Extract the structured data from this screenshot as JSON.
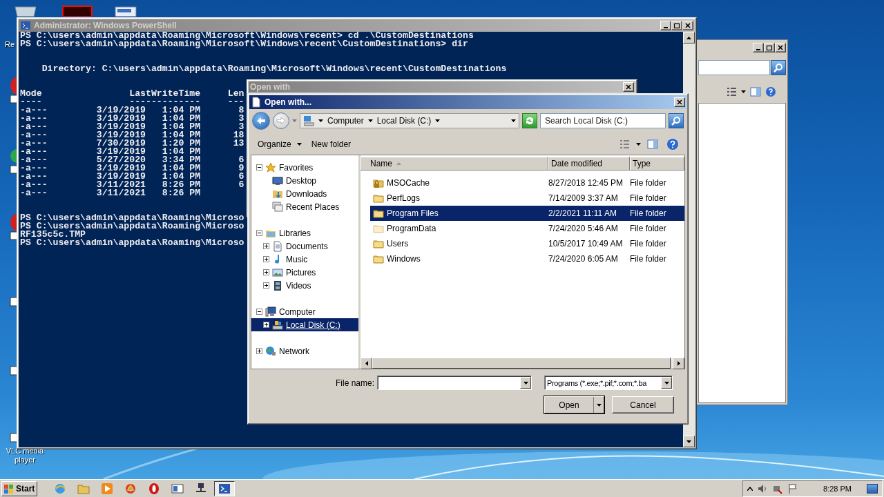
{
  "desktop": {
    "icon_labels": [
      "Re",
      "VLC media player"
    ]
  },
  "powershell": {
    "title": "Administrator: Windows PowerShell",
    "blocks": [
      {
        "lines": [
          "PS C:\\users\\admin\\appdata\\Roaming\\Microsoft\\Windows\\recent> cd .\\CustomDestinations",
          "PS C:\\users\\admin\\appdata\\Roaming\\Microsoft\\Windows\\recent\\CustomDestinations> dir"
        ]
      },
      {
        "lines": [
          "    Directory: C:\\users\\admin\\appdata\\Roaming\\Microsoft\\Windows\\recent\\CustomDestinations"
        ]
      },
      {
        "lines": [
          "Mode                LastWriteTime     Len",
          "----                -------------     ---",
          "-a---         3/19/2019   1:04 PM       8",
          "-a---         3/19/2019   1:04 PM       3",
          "-a---         3/19/2019   1:04 PM       3",
          "-a---         3/19/2019   1:04 PM      18",
          "-a---         7/30/2019   1:20 PM      13",
          "-a---         3/19/2019   1:04 PM",
          "-a---         5/27/2020   3:34 PM       6",
          "-a---         3/19/2019   1:04 PM       9",
          "-a---         3/19/2019   1:04 PM       6",
          "-a---         3/11/2021   8:26 PM       6",
          "-a---         3/11/2021   8:26 PM"
        ]
      },
      {
        "lines": [
          "PS C:\\users\\admin\\appdata\\Roaming\\Microso",
          "PS C:\\users\\admin\\appdata\\Roaming\\Microso",
          "RF135c5c.TMP",
          "PS C:\\users\\admin\\appdata\\Roaming\\Microso"
        ]
      }
    ]
  },
  "back_dialog": {
    "title": "Open with"
  },
  "dialog": {
    "title": "Open with...",
    "breadcrumb": [
      "Computer",
      "Local Disk (C:)"
    ],
    "search": {
      "placeholder": "Search Local Disk (C:)"
    },
    "toolbar": [
      "Organize",
      "New folder"
    ],
    "nav": {
      "groups": [
        {
          "label": "Favorites",
          "expanded": true,
          "selected": false,
          "children": [
            {
              "label": "Desktop",
              "selected": false
            },
            {
              "label": "Downloads",
              "selected": false
            },
            {
              "label": "Recent Places",
              "selected": false
            }
          ]
        },
        {
          "label": "Libraries",
          "expanded": true,
          "selected": false,
          "children": [
            {
              "label": "Documents",
              "expanded": false,
              "selected": false
            },
            {
              "label": "Music",
              "expanded": false,
              "selected": false
            },
            {
              "label": "Pictures",
              "expanded": false,
              "selected": false
            },
            {
              "label": "Videos",
              "expanded": false,
              "selected": false
            }
          ]
        },
        {
          "label": "Computer",
          "expanded": true,
          "selected": false,
          "children": [
            {
              "label": "Local Disk (C:)",
              "expanded": false,
              "selected": true
            }
          ]
        },
        {
          "label": "Network",
          "expanded": false,
          "selected": false
        }
      ]
    },
    "columns": [
      "Name",
      "Date modified",
      "Type"
    ],
    "rows": [
      {
        "name": "MSOCache",
        "date": "8/27/2018 12:45 PM",
        "type": "File folder",
        "selected": false,
        "locked": true,
        "hidden": false
      },
      {
        "name": "PerfLogs",
        "date": "7/14/2009 3:37 AM",
        "type": "File folder",
        "selected": false,
        "locked": false,
        "hidden": false
      },
      {
        "name": "Program Files",
        "date": "2/2/2021 11:11 AM",
        "type": "File folder",
        "selected": true,
        "locked": false,
        "hidden": false
      },
      {
        "name": "ProgramData",
        "date": "7/24/2020 5:46 AM",
        "type": "File folder",
        "selected": false,
        "locked": false,
        "hidden": true
      },
      {
        "name": "Users",
        "date": "10/5/2017 10:49 AM",
        "type": "File folder",
        "selected": false,
        "locked": false,
        "hidden": false
      },
      {
        "name": "Windows",
        "date": "7/24/2020 6:05 AM",
        "type": "File folder",
        "selected": false,
        "locked": false,
        "hidden": false
      }
    ],
    "file_name_label": "File name:",
    "file_type": "Programs (*.exe;*.pif;*.com;*.ba",
    "buttons": [
      "Open",
      "Cancel"
    ]
  },
  "taskbar": {
    "start": "Start",
    "buttons": [
      {
        "selected": false
      },
      {
        "selected": false
      },
      {
        "selected": false
      },
      {
        "selected": false
      },
      {
        "selected": false
      },
      {
        "selected": false
      },
      {
        "selected": false
      },
      {
        "selected": true
      }
    ],
    "clock": "8:28 PM"
  }
}
